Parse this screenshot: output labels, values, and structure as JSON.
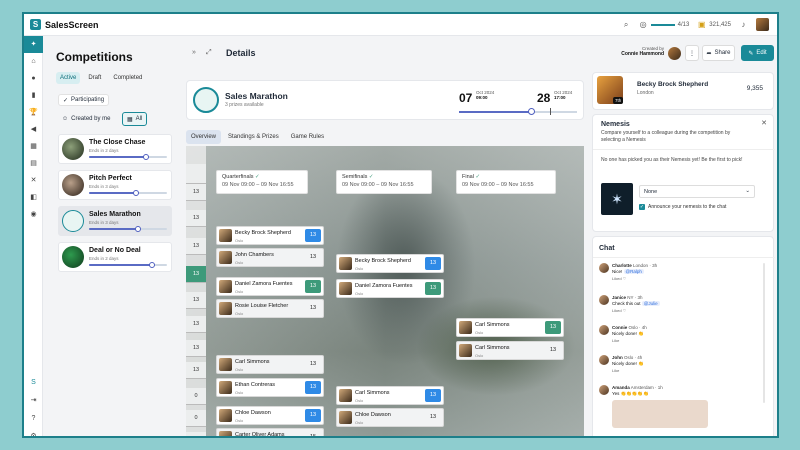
{
  "app": {
    "name": "SalesScreen",
    "header_stats": {
      "a": "4/13",
      "b": "321,425"
    }
  },
  "sidebar": {
    "items": [
      "home",
      "chat",
      "chart",
      "trophy",
      "megaphone",
      "calendar",
      "gift",
      "sliders",
      "map"
    ]
  },
  "left": {
    "title": "Competitions",
    "tabs": [
      "Active",
      "Draft",
      "Completed"
    ],
    "participating": "Participating",
    "created_by_me": "Created by me",
    "all": "All",
    "competitions": [
      {
        "name": "The Close Chase",
        "ends": "Ends in 2 days",
        "progress": 0.72
      },
      {
        "name": "Pitch Perfect",
        "ends": "Ends in 3 days",
        "progress": 0.6
      },
      {
        "name": "Sales Marathon",
        "ends": "Ends in 3 days",
        "progress": 0.62
      },
      {
        "name": "Deal or No Deal",
        "ends": "Ends in 2 days",
        "progress": 0.8
      }
    ]
  },
  "main": {
    "title": "Details",
    "created_by_label": "Created by",
    "created_by_name": "Connie Hammond",
    "share": "Share",
    "edit": "Edit",
    "competition": {
      "name": "Sales Marathon",
      "prizes": "3 prizes available",
      "start_day": "07",
      "start_month": "Oct 2024",
      "start_time": "09:00",
      "end_day": "28",
      "end_month": "Oct 2024",
      "end_time": "17:00",
      "progress": 0.62
    },
    "tabs": [
      "Overview",
      "Standings & Prizes",
      "Game Rules"
    ],
    "rounds": [
      {
        "name": "Quarterfinals",
        "dates": "09 Nov 09:00 – 09 Nov 16:55"
      },
      {
        "name": "Semifinals",
        "dates": "09 Nov 09:00 – 09 Nov 16:55"
      },
      {
        "name": "Final",
        "dates": "09 Nov 09:00 – 09 Nov 16:55"
      }
    ],
    "positions": [
      "",
      "13",
      "13",
      "13",
      "13",
      "13",
      "13",
      "13",
      "13",
      "0",
      "0",
      "0",
      "0"
    ],
    "quarterfinals": [
      {
        "name": "Becky Brock Shepherd",
        "office": "Oslo",
        "score": "13",
        "win": true,
        "badge": "blue"
      },
      {
        "name": "John Chambers",
        "office": "Oslo",
        "score": "13",
        "win": false,
        "badge": ""
      },
      {
        "name": "Daniel Zamora Fuentes",
        "office": "Oslo",
        "score": "13",
        "win": true,
        "badge": "green"
      },
      {
        "name": "Rosie Louise Fletcher",
        "office": "Oslo",
        "score": "13",
        "win": false,
        "badge": ""
      },
      {
        "name": "Carl Simmons",
        "office": "Oslo",
        "score": "13",
        "win": false,
        "badge": ""
      },
      {
        "name": "Ethan Contreras",
        "office": "Oslo",
        "score": "13",
        "win": true,
        "badge": "blue"
      },
      {
        "name": "Chloe Dawson",
        "office": "Oslo",
        "score": "13",
        "win": true,
        "badge": "blue"
      },
      {
        "name": "Carter Oliver Adams",
        "office": "Oslo",
        "score": "15",
        "win": false,
        "badge": ""
      }
    ],
    "semifinals": [
      {
        "name": "Becky Brock Shepherd",
        "office": "Oslo",
        "score": "13",
        "win": true,
        "badge": "blue"
      },
      {
        "name": "Daniel Zamora Fuentes",
        "office": "Oslo",
        "score": "13",
        "win": true,
        "badge": "green"
      },
      {
        "name": "Carl Simmons",
        "office": "Oslo",
        "score": "13",
        "win": true,
        "badge": "blue"
      },
      {
        "name": "Chloe Dawson",
        "office": "Oslo",
        "score": "13",
        "win": false,
        "badge": ""
      }
    ],
    "final": [
      {
        "name": "Carl Simmons",
        "office": "Oslo",
        "score": "13",
        "win": true,
        "badge": "green"
      },
      {
        "name": "Carl Simmons",
        "office": "Oslo",
        "score": "13",
        "win": false,
        "badge": ""
      }
    ]
  },
  "right": {
    "user": {
      "name": "Becky Brock Shepherd",
      "location": "London",
      "rank": "7th",
      "score": "9,355"
    },
    "nemesis": {
      "title": "Nemesis",
      "desc": "Compare yourself to a colleague during the competition by selecting a Nemesis",
      "none_msg": "No one has picked you as their Nemesis yet! Be the first to pick!",
      "select": "None",
      "announce": "Announce your nemesis to the chat"
    },
    "chat": {
      "title": "Chat",
      "messages": [
        {
          "name": "Charlotte",
          "loc": "London",
          "time": "3h",
          "text": "Nice!",
          "mention": "@Ralph",
          "likes": "Liked"
        },
        {
          "name": "Janice",
          "loc": "NY",
          "time": "3h",
          "text": "Check this out",
          "mention": "@Julie",
          "likes": "Liked"
        },
        {
          "name": "Connie",
          "loc": "Oslo",
          "time": "4h",
          "text": "Nicely done! 👏",
          "mention": "",
          "likes": "Like"
        },
        {
          "name": "John",
          "loc": "Oslo",
          "time": "4h",
          "text": "Nicely done! 👏",
          "mention": "",
          "likes": "Like"
        },
        {
          "name": "Amanda",
          "loc": "Amsterdam",
          "time": "1h",
          "text": "Yes 👏👏👏👏👏",
          "mention": "",
          "likes": ""
        }
      ]
    }
  }
}
